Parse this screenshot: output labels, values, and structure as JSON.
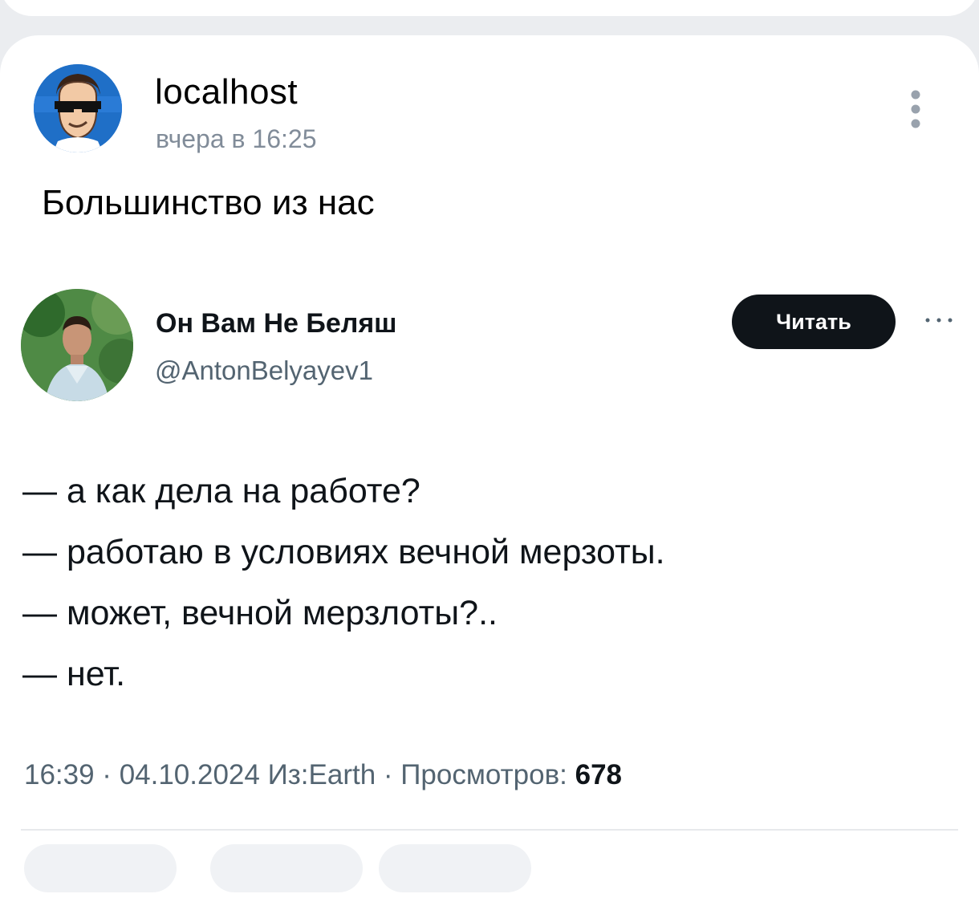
{
  "post": {
    "author": "localhost",
    "time": "вчера в 16:25",
    "text": "Большинство из нас"
  },
  "tweet": {
    "name": "Он Вам Не Беляш",
    "handle": "@AntonBelyayev1",
    "follow_label": "Читать",
    "lines": [
      "— а как дела на работе?",
      "— работаю в условиях вечной мерзоты.",
      "— может, вечной мерзлоты?..",
      "— нет."
    ],
    "meta_prefix": "16:39 · 04.10.2024 Из:Earth · Просмотров: ",
    "views": "678"
  },
  "icons": {
    "more": "vertical-dots-icon",
    "tweet_more": "horizontal-dots-icon"
  },
  "colors": {
    "background": "#ebedf0",
    "card": "#ffffff",
    "muted_text": "#818c99",
    "follow_button": "#0f1419"
  }
}
